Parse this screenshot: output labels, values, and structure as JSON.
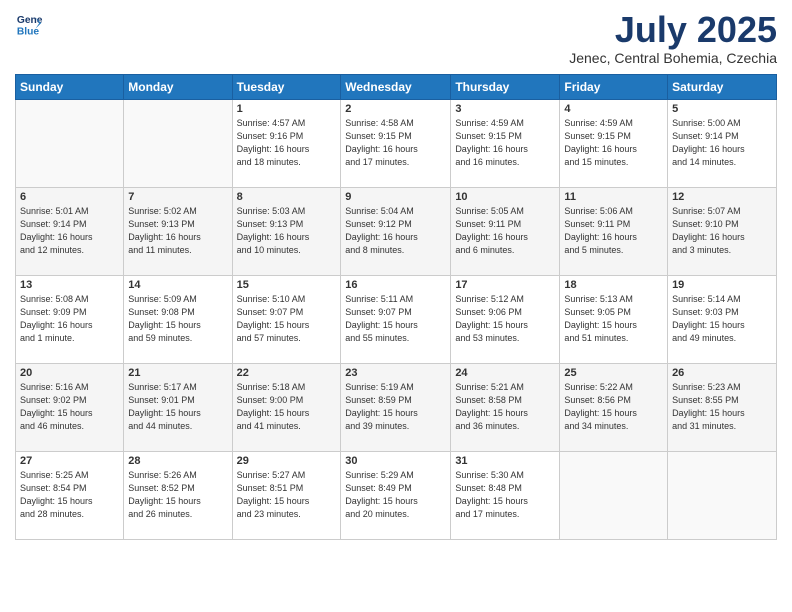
{
  "header": {
    "logo_line1": "General",
    "logo_line2": "Blue",
    "month": "July 2025",
    "location": "Jenec, Central Bohemia, Czechia"
  },
  "weekdays": [
    "Sunday",
    "Monday",
    "Tuesday",
    "Wednesday",
    "Thursday",
    "Friday",
    "Saturday"
  ],
  "rows": [
    [
      {
        "day": "",
        "info": ""
      },
      {
        "day": "",
        "info": ""
      },
      {
        "day": "1",
        "info": "Sunrise: 4:57 AM\nSunset: 9:16 PM\nDaylight: 16 hours\nand 18 minutes."
      },
      {
        "day": "2",
        "info": "Sunrise: 4:58 AM\nSunset: 9:15 PM\nDaylight: 16 hours\nand 17 minutes."
      },
      {
        "day": "3",
        "info": "Sunrise: 4:59 AM\nSunset: 9:15 PM\nDaylight: 16 hours\nand 16 minutes."
      },
      {
        "day": "4",
        "info": "Sunrise: 4:59 AM\nSunset: 9:15 PM\nDaylight: 16 hours\nand 15 minutes."
      },
      {
        "day": "5",
        "info": "Sunrise: 5:00 AM\nSunset: 9:14 PM\nDaylight: 16 hours\nand 14 minutes."
      }
    ],
    [
      {
        "day": "6",
        "info": "Sunrise: 5:01 AM\nSunset: 9:14 PM\nDaylight: 16 hours\nand 12 minutes."
      },
      {
        "day": "7",
        "info": "Sunrise: 5:02 AM\nSunset: 9:13 PM\nDaylight: 16 hours\nand 11 minutes."
      },
      {
        "day": "8",
        "info": "Sunrise: 5:03 AM\nSunset: 9:13 PM\nDaylight: 16 hours\nand 10 minutes."
      },
      {
        "day": "9",
        "info": "Sunrise: 5:04 AM\nSunset: 9:12 PM\nDaylight: 16 hours\nand 8 minutes."
      },
      {
        "day": "10",
        "info": "Sunrise: 5:05 AM\nSunset: 9:11 PM\nDaylight: 16 hours\nand 6 minutes."
      },
      {
        "day": "11",
        "info": "Sunrise: 5:06 AM\nSunset: 9:11 PM\nDaylight: 16 hours\nand 5 minutes."
      },
      {
        "day": "12",
        "info": "Sunrise: 5:07 AM\nSunset: 9:10 PM\nDaylight: 16 hours\nand 3 minutes."
      }
    ],
    [
      {
        "day": "13",
        "info": "Sunrise: 5:08 AM\nSunset: 9:09 PM\nDaylight: 16 hours\nand 1 minute."
      },
      {
        "day": "14",
        "info": "Sunrise: 5:09 AM\nSunset: 9:08 PM\nDaylight: 15 hours\nand 59 minutes."
      },
      {
        "day": "15",
        "info": "Sunrise: 5:10 AM\nSunset: 9:07 PM\nDaylight: 15 hours\nand 57 minutes."
      },
      {
        "day": "16",
        "info": "Sunrise: 5:11 AM\nSunset: 9:07 PM\nDaylight: 15 hours\nand 55 minutes."
      },
      {
        "day": "17",
        "info": "Sunrise: 5:12 AM\nSunset: 9:06 PM\nDaylight: 15 hours\nand 53 minutes."
      },
      {
        "day": "18",
        "info": "Sunrise: 5:13 AM\nSunset: 9:05 PM\nDaylight: 15 hours\nand 51 minutes."
      },
      {
        "day": "19",
        "info": "Sunrise: 5:14 AM\nSunset: 9:03 PM\nDaylight: 15 hours\nand 49 minutes."
      }
    ],
    [
      {
        "day": "20",
        "info": "Sunrise: 5:16 AM\nSunset: 9:02 PM\nDaylight: 15 hours\nand 46 minutes."
      },
      {
        "day": "21",
        "info": "Sunrise: 5:17 AM\nSunset: 9:01 PM\nDaylight: 15 hours\nand 44 minutes."
      },
      {
        "day": "22",
        "info": "Sunrise: 5:18 AM\nSunset: 9:00 PM\nDaylight: 15 hours\nand 41 minutes."
      },
      {
        "day": "23",
        "info": "Sunrise: 5:19 AM\nSunset: 8:59 PM\nDaylight: 15 hours\nand 39 minutes."
      },
      {
        "day": "24",
        "info": "Sunrise: 5:21 AM\nSunset: 8:58 PM\nDaylight: 15 hours\nand 36 minutes."
      },
      {
        "day": "25",
        "info": "Sunrise: 5:22 AM\nSunset: 8:56 PM\nDaylight: 15 hours\nand 34 minutes."
      },
      {
        "day": "26",
        "info": "Sunrise: 5:23 AM\nSunset: 8:55 PM\nDaylight: 15 hours\nand 31 minutes."
      }
    ],
    [
      {
        "day": "27",
        "info": "Sunrise: 5:25 AM\nSunset: 8:54 PM\nDaylight: 15 hours\nand 28 minutes."
      },
      {
        "day": "28",
        "info": "Sunrise: 5:26 AM\nSunset: 8:52 PM\nDaylight: 15 hours\nand 26 minutes."
      },
      {
        "day": "29",
        "info": "Sunrise: 5:27 AM\nSunset: 8:51 PM\nDaylight: 15 hours\nand 23 minutes."
      },
      {
        "day": "30",
        "info": "Sunrise: 5:29 AM\nSunset: 8:49 PM\nDaylight: 15 hours\nand 20 minutes."
      },
      {
        "day": "31",
        "info": "Sunrise: 5:30 AM\nSunset: 8:48 PM\nDaylight: 15 hours\nand 17 minutes."
      },
      {
        "day": "",
        "info": ""
      },
      {
        "day": "",
        "info": ""
      }
    ]
  ]
}
